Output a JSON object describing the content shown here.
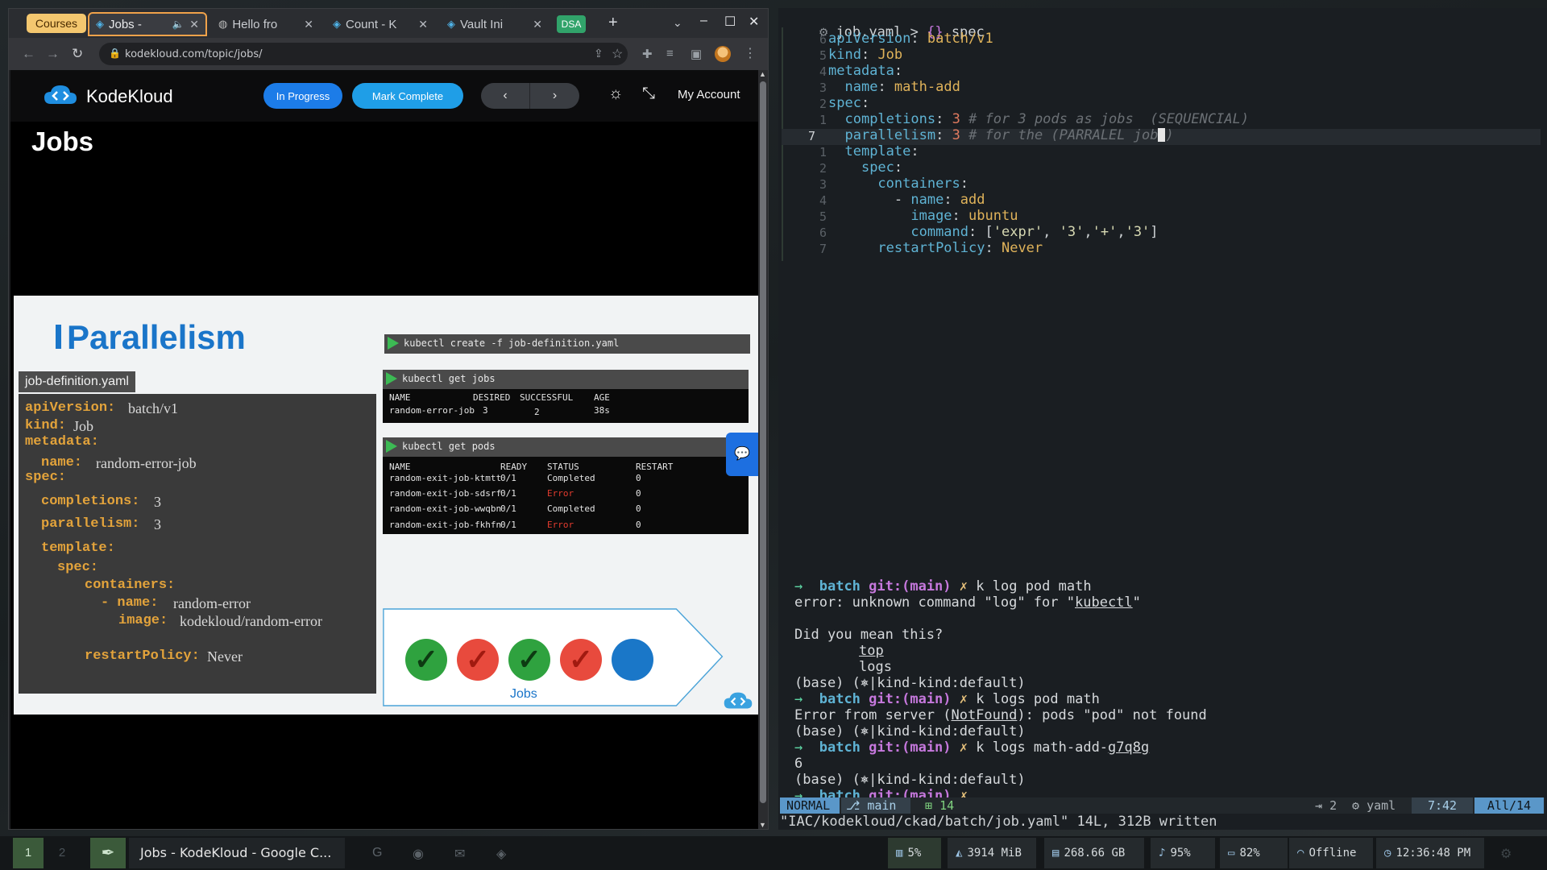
{
  "browser": {
    "tabs": [
      {
        "label": "Courses"
      },
      {
        "label": "Jobs -",
        "audio_icon": "speaker-icon"
      },
      {
        "label": "Hello fro"
      },
      {
        "label": "Count - K"
      },
      {
        "label": "Vault Ini"
      },
      {
        "label": "DSA"
      }
    ],
    "url": "kodekloud.com/topic/jobs/"
  },
  "kodekloud": {
    "brand": "KodeKloud",
    "in_progress_label": "In Progress",
    "mark_complete_label": "Mark Complete",
    "prev_label": "‹",
    "next_label": "›",
    "account_label": "My Account",
    "page_title": "Jobs"
  },
  "slide": {
    "title": "Parallelism",
    "yaml_filename": "job-definition.yaml",
    "yaml": [
      {
        "key": "apiVersion:",
        "value": "batch/v1"
      },
      {
        "key": "kind:",
        "value": "Job"
      },
      {
        "key": "metadata:",
        "value": ""
      },
      {
        "key": "name:",
        "value": "random-error-job"
      },
      {
        "key": "spec:",
        "value": ""
      },
      {
        "key": "completions:",
        "value": "3"
      },
      {
        "key": "parallelism:",
        "value": "3"
      },
      {
        "key": "template:",
        "value": ""
      },
      {
        "key": "spec:",
        "value": ""
      },
      {
        "key": "containers:",
        "value": ""
      },
      {
        "key": "- name:",
        "value": "random-error"
      },
      {
        "key": "image:",
        "value": "kodekloud/random-error"
      },
      {
        "key": "restartPolicy:",
        "value": "Never"
      }
    ],
    "cmd_create": "kubectl create -f job-definition.yaml",
    "cmd_get_jobs": "kubectl get jobs",
    "jobs_headers": [
      "NAME",
      "DESIRED",
      "SUCCESSFUL",
      "AGE"
    ],
    "jobs_row": [
      "random-error-job",
      "3",
      "2",
      "38s"
    ],
    "cmd_get_pods": "kubectl get pods",
    "pods_headers": [
      "NAME",
      "READY",
      "STATUS",
      "RESTART"
    ],
    "pods_rows": [
      [
        "random-exit-job-ktmtt",
        "0/1",
        "Completed",
        "0"
      ],
      [
        "random-exit-job-sdsrf",
        "0/1",
        "Error",
        "0"
      ],
      [
        "random-exit-job-wwqbn",
        "0/1",
        "Completed",
        "0"
      ],
      [
        "random-exit-job-fkhfn",
        "0/1",
        "Error",
        "0"
      ]
    ],
    "jobs_label": "Jobs",
    "job_states": [
      "success",
      "error",
      "success",
      "error",
      "pending"
    ]
  },
  "editor": {
    "breadcrumb_file": "job.yaml",
    "breadcrumb_sep": ">",
    "breadcrumb_symbol": "spec",
    "line_numbers": [
      "6",
      "5",
      "4",
      "3",
      "2",
      "1",
      "7",
      "1",
      "2",
      "3",
      "4",
      "5",
      "6",
      "7"
    ],
    "mode": "NORMAL",
    "branch": "main",
    "diagnostics": "14",
    "indent": "2",
    "filetype": "yaml",
    "position": "7:42",
    "percent": "All/14",
    "message": "\"IAC/kodekloud/ckad/batch/job.yaml\" 14L, 312B written"
  },
  "terminal": {
    "prompt_dir": "batch",
    "git_label": "git:(main)",
    "dirty_mark": "✗",
    "k8s_context": "(base) (⎈|kind-kind:default)",
    "cmd1": "k log pod math",
    "err1_a": "error: unknown command \"log\" for \"",
    "err1_b": "kubectl",
    "err1_c": "\"",
    "did_you_mean": "Did you mean this?",
    "sug1": "top",
    "sug2": "logs",
    "cmd2": "k logs pod math",
    "err2_a": "Error from server (",
    "err2_b": "NotFound",
    "err2_c": "): pods \"pod\" not found",
    "cmd3_a": "k logs math-add-",
    "cmd3_b": "g7q8g",
    "output": "6"
  },
  "taskbar": {
    "workspace_1": "1",
    "workspace_2": "2",
    "window_title": "Jobs - KodeKloud - Google C...",
    "cpu": "5%",
    "memory": "3914 MiB",
    "disk": "268.66 GB",
    "volume": "95%",
    "battery": "82%",
    "network": "Offline",
    "clock": "12:36:48 PM"
  },
  "colors": {
    "kodekloud_blue": "#1a75c9",
    "success_green": "#2fa23f",
    "error_red": "#e84a3d",
    "accent_orange": "#f0a24a"
  }
}
